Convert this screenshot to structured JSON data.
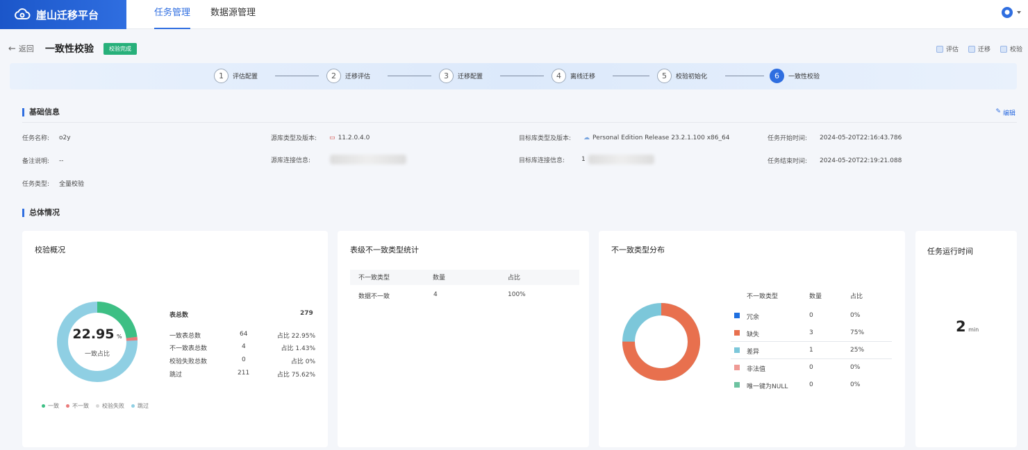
{
  "app": {
    "title": "崖山迁移平台"
  },
  "nav": {
    "tabs": [
      "任务管理",
      "数据源管理"
    ]
  },
  "header": {
    "back": "返回",
    "title": "一致性校验",
    "status": "校验完成"
  },
  "options": [
    "评估",
    "迁移",
    "校验"
  ],
  "steps": [
    {
      "num": "1",
      "label": "评估配置"
    },
    {
      "num": "2",
      "label": "迁移评估"
    },
    {
      "num": "3",
      "label": "迁移配置"
    },
    {
      "num": "4",
      "label": "离线迁移"
    },
    {
      "num": "5",
      "label": "校验初始化"
    },
    {
      "num": "6",
      "label": "一致性校验"
    }
  ],
  "basic": {
    "title": "基础信息",
    "edit": "编辑",
    "task_name_k": "任务名称:",
    "task_name_v": "o2y",
    "src_type_k": "源库类型及版本:",
    "src_type_v": "11.2.0.4.0",
    "tgt_type_k": "目标库类型及版本:",
    "tgt_type_v": "Personal Edition Release 23.2.1.100 x86_64",
    "start_k": "任务开始时间:",
    "start_v": "2024-05-20T22:16:43.786",
    "remark_k": "备注说明:",
    "remark_v": "--",
    "src_conn_k": "源库连接信息:",
    "tgt_conn_k": "目标库连接信息:",
    "tgt_conn_v": "1",
    "end_k": "任务结束时间:",
    "end_v": "2024-05-20T22:19:21.088",
    "type_k": "任务类型:",
    "type_v": "全量校验"
  },
  "overall": {
    "title": "总体情况"
  },
  "overview": {
    "title": "校验概况",
    "percent_int": "22.95",
    "percent_unit": "%",
    "percent_label": "一致占比",
    "total_k": "表总数",
    "total_v": "279",
    "rows": [
      {
        "k": "一致表总数",
        "v": "64",
        "ratio": "占比 22.95%"
      },
      {
        "k": "不一致表总数",
        "v": "4",
        "ratio": "占比 1.43%"
      },
      {
        "k": "校验失败总数",
        "v": "0",
        "ratio": "占比 0%"
      },
      {
        "k": "跳过",
        "v": "211",
        "ratio": "占比 75.62%"
      }
    ],
    "legend": [
      "一致",
      "不一致",
      "校验失败",
      "跳过"
    ],
    "colors": [
      "#3dbf84",
      "#ea7a7a",
      "#d8d8d8",
      "#8fcfe3"
    ]
  },
  "table_stats": {
    "title": "表级不一致类型统计",
    "headers": [
      "不一致类型",
      "数量",
      "占比"
    ],
    "rows": [
      {
        "type": "数据不一致",
        "count": "4",
        "ratio": "100%"
      }
    ]
  },
  "distribution": {
    "title": "不一致类型分布",
    "headers": [
      "不一致类型",
      "数量",
      "占比"
    ],
    "rows": [
      {
        "type": "冗余",
        "count": "0",
        "ratio": "0%",
        "color": "#1f6fe0"
      },
      {
        "type": "缺失",
        "count": "3",
        "ratio": "75%",
        "color": "#e8704e"
      },
      {
        "type": "差异",
        "count": "1",
        "ratio": "25%",
        "color": "#7cc7da"
      },
      {
        "type": "非法值",
        "count": "0",
        "ratio": "0%",
        "color": "#ef9a95"
      },
      {
        "type": "唯一键为NULL",
        "count": "0",
        "ratio": "0%",
        "color": "#6cc2a0"
      }
    ]
  },
  "runtime": {
    "title": "任务运行时间",
    "value": "2",
    "unit": "min"
  }
}
